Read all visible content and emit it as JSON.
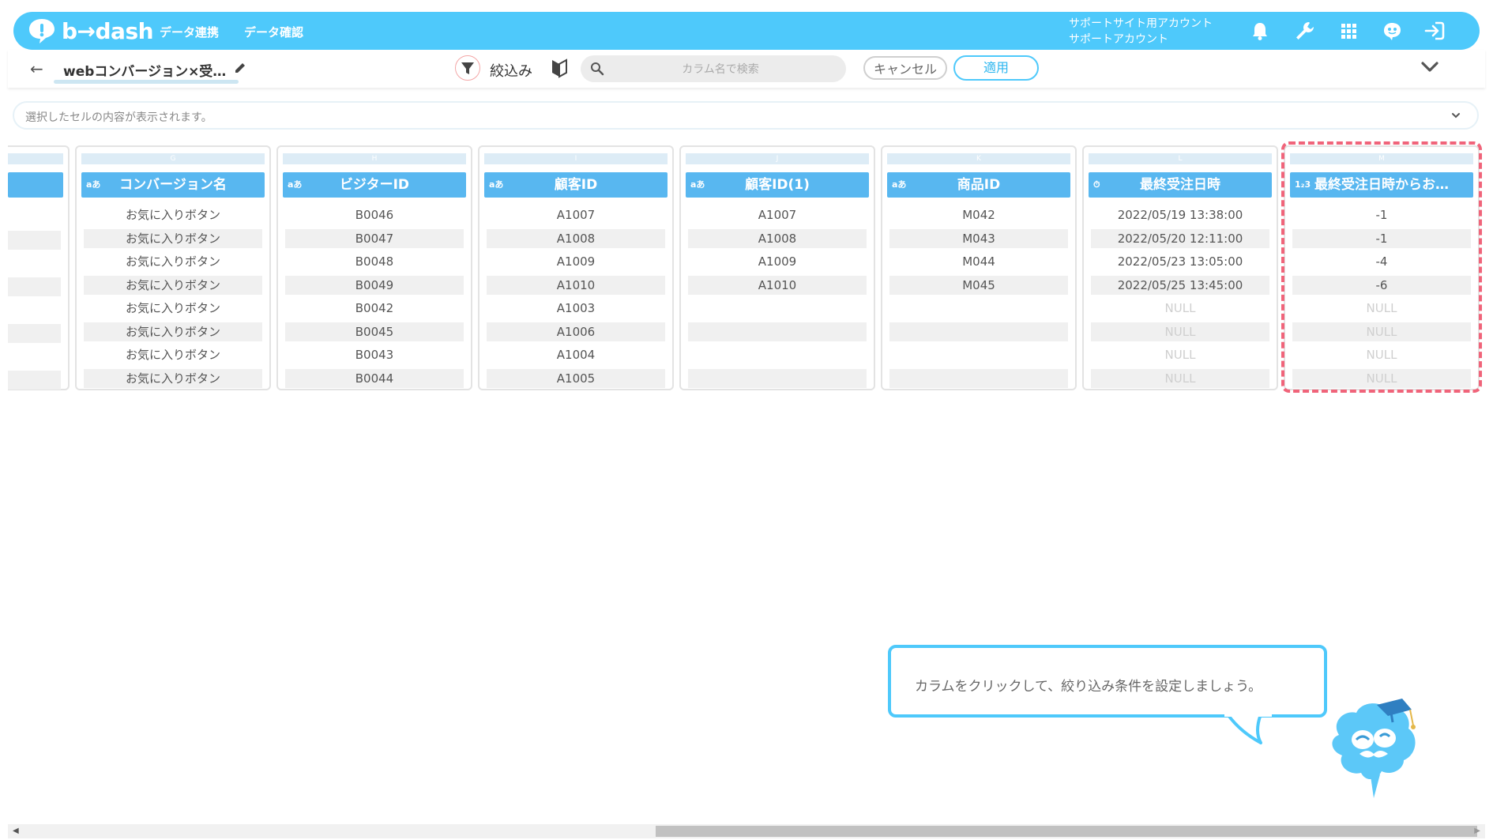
{
  "app": {
    "logo_text": "b→dash",
    "nav": [
      "データ連携",
      "データ確認"
    ],
    "account_line1": "サポートサイト用アカウント",
    "account_line2": "サポートアカウント",
    "brand_color": "#4ec9fb"
  },
  "toolbar": {
    "title": "webコンバージョン×受…",
    "filter_label": "絞込み",
    "search_placeholder": "カラム名で検索",
    "cancel_label": "キャンセル",
    "apply_label": "適用"
  },
  "cell_preview": {
    "placeholder": "選択したセルの内容が表示されます。"
  },
  "table": {
    "columns": [
      {
        "letter": "G",
        "type": "aあ",
        "header": "コンバージョン名",
        "cells": [
          "お気に入りボタン",
          "お気に入りボタン",
          "お気に入りボタン",
          "お気に入りボタン",
          "お気に入りボタン",
          "お気に入りボタン",
          "お気に入りボタン",
          "お気に入りボタン"
        ]
      },
      {
        "letter": "H",
        "type": "aあ",
        "header": "ビジターID",
        "cells": [
          "B0046",
          "B0047",
          "B0048",
          "B0049",
          "B0042",
          "B0045",
          "B0043",
          "B0044"
        ]
      },
      {
        "letter": "I",
        "type": "aあ",
        "header": "顧客ID",
        "cells": [
          "A1007",
          "A1008",
          "A1009",
          "A1010",
          "A1003",
          "A1006",
          "A1004",
          "A1005"
        ]
      },
      {
        "letter": "J",
        "type": "aあ",
        "header": "顧客ID(1)",
        "cells": [
          "A1007",
          "A1008",
          "A1009",
          "A1010",
          "",
          "",
          "",
          ""
        ]
      },
      {
        "letter": "K",
        "type": "aあ",
        "header": "商品ID",
        "cells": [
          "M042",
          "M043",
          "M044",
          "M045",
          "",
          "",
          "",
          ""
        ]
      },
      {
        "letter": "L",
        "type": "⏱",
        "header": "最終受注日時",
        "cells": [
          "2022/05/19 13:38:00",
          "2022/05/20 12:11:00",
          "2022/05/23 13:05:00",
          "2022/05/25 13:45:00",
          "NULL",
          "NULL",
          "NULL",
          "NULL"
        ]
      },
      {
        "letter": "M",
        "type": "1₂3",
        "header": "最終受注日時からお…",
        "cells": [
          "-1",
          "-1",
          "-4",
          "-6",
          "NULL",
          "NULL",
          "NULL",
          "NULL"
        ]
      }
    ]
  },
  "hint": {
    "text": "カラムをクリックして、絞り込み条件を設定しましょう。"
  }
}
